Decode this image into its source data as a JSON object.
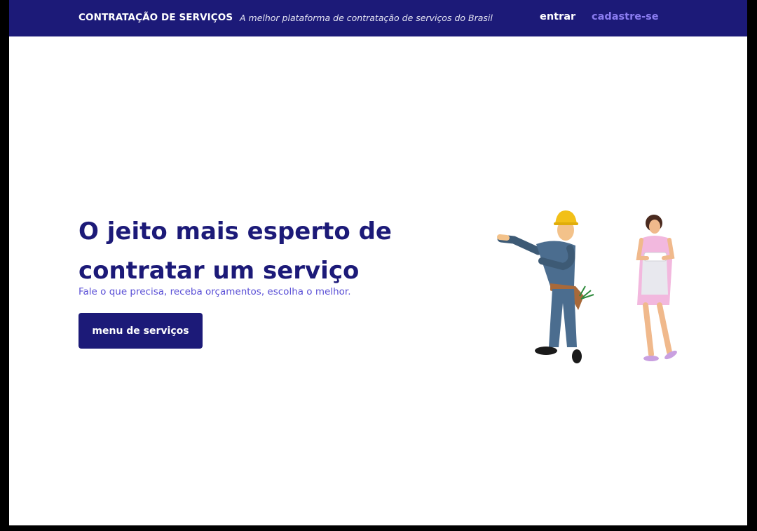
{
  "navbar": {
    "brand": "CONTRATAÇÃO DE SERVIÇOS",
    "tagline": "A melhor plataforma de contratação de serviços do Brasil",
    "login_label": "entrar",
    "signup_label": "cadastre-se"
  },
  "hero": {
    "title_line1": "O jeito mais esperto de",
    "title_line2": "contratar um serviço",
    "subtitle": "Fale o que precisa, receba orçamentos, escolha o melhor.",
    "cta_label": "menu de serviços"
  },
  "colors": {
    "navbar_bg": "#1c1a78",
    "accent": "#8a7cf0",
    "title": "#1c1a78",
    "subtitle": "#5a4fd6"
  }
}
